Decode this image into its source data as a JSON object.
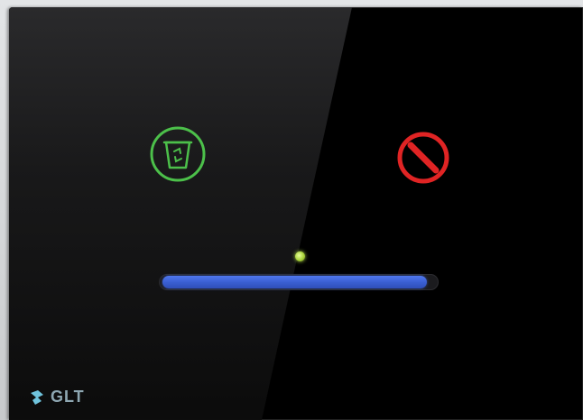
{
  "panel": {
    "brand": "GLT",
    "buttons": [
      {
        "name": "bin",
        "icon": "waste-bin-icon",
        "color": "#4cc04a"
      },
      {
        "name": "no-entry",
        "icon": "no-entry-icon",
        "color": "#e02424"
      }
    ],
    "indicator_color": "#b6e04a",
    "slider": {
      "level": 0.97,
      "color": "#3a5fd3"
    }
  }
}
